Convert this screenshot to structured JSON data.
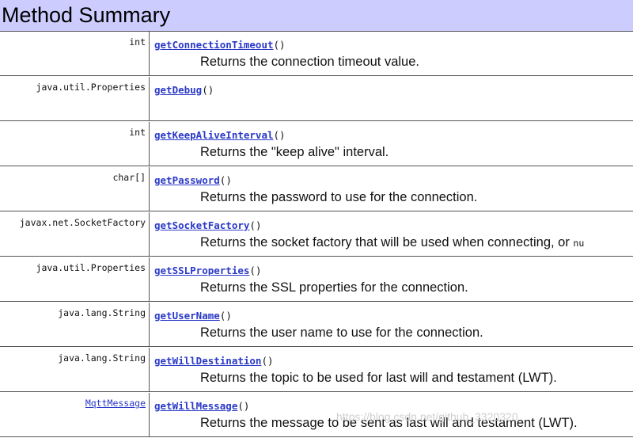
{
  "header": {
    "title": "Method Summary"
  },
  "rows": [
    {
      "ret": "int",
      "method": "getConnectionTimeout",
      "paren": "()",
      "desc": "Returns the connection timeout value."
    },
    {
      "ret": "java.util.Properties",
      "method": "getDebug",
      "paren": "()",
      "desc": ""
    },
    {
      "ret": "int",
      "method": "getKeepAliveInterval",
      "paren": "()",
      "desc": "Returns the \"keep alive\" interval."
    },
    {
      "ret": "char[]",
      "method": "getPassword",
      "paren": "()",
      "desc": "Returns the password to use for the connection."
    },
    {
      "ret": "javax.net.SocketFactory",
      "method": "getSocketFactory",
      "paren": "()",
      "desc": "Returns the socket factory that will be used when connecting, or ",
      "desc_code": "nu"
    },
    {
      "ret": "java.util.Properties",
      "method": "getSSLProperties",
      "paren": "()",
      "desc": "Returns the SSL properties for the connection."
    },
    {
      "ret": "java.lang.String",
      "method": "getUserName",
      "paren": "()",
      "desc": "Returns the user name to use for the connection."
    },
    {
      "ret": "java.lang.String",
      "method": "getWillDestination",
      "paren": "()",
      "desc": "Returns the topic to be used for last will and testament (LWT)."
    },
    {
      "ret": "MqttMessage",
      "ret_link": true,
      "method": "getWillMessage",
      "paren": "()",
      "desc": "Returns the message to be sent as last will and testament (LWT)."
    }
  ],
  "watermark": "https://blog.csdn.net/github_3320320"
}
